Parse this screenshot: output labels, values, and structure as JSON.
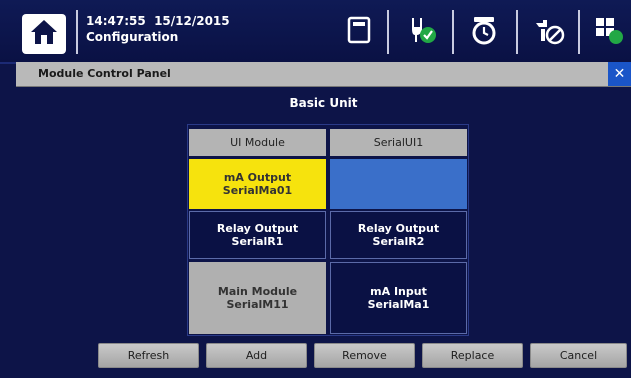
{
  "header": {
    "time": "14:47:55",
    "date": "15/12/2015",
    "screen_name": "Configuration",
    "icons": [
      "home-icon",
      "memory-card-icon",
      "power-plug-check-icon",
      "alarm-clock-icon",
      "tools-disabled-icon",
      "module-grid-icon"
    ]
  },
  "dialog": {
    "title": "Module Control Panel",
    "close_label": "✕",
    "panel_title": "Basic Unit",
    "columns": [
      "UI Module",
      "SerialUI1"
    ],
    "modules": [
      {
        "name": "mA Output",
        "serial": "SerialMa01",
        "state": "selected"
      },
      {
        "name": "",
        "serial": "",
        "state": "empty"
      },
      {
        "name": "Relay Output",
        "serial": "SerialR1",
        "state": "normal"
      },
      {
        "name": "Relay Output",
        "serial": "SerialR2",
        "state": "normal"
      },
      {
        "name": "Main Module",
        "serial": "SerialM11",
        "state": "fixed"
      },
      {
        "name": "mA Input",
        "serial": "SerialMa1",
        "state": "normal"
      }
    ],
    "buttons": {
      "refresh": "Refresh",
      "add": "Add",
      "remove": "Remove",
      "replace": "Replace",
      "cancel": "Cancel"
    }
  },
  "colors": {
    "background": "#0d1448",
    "selected": "#f6e30d",
    "empty_slot": "#3a6fc9",
    "title_bar": "#b9b9b9",
    "close": "#1a55c8"
  }
}
